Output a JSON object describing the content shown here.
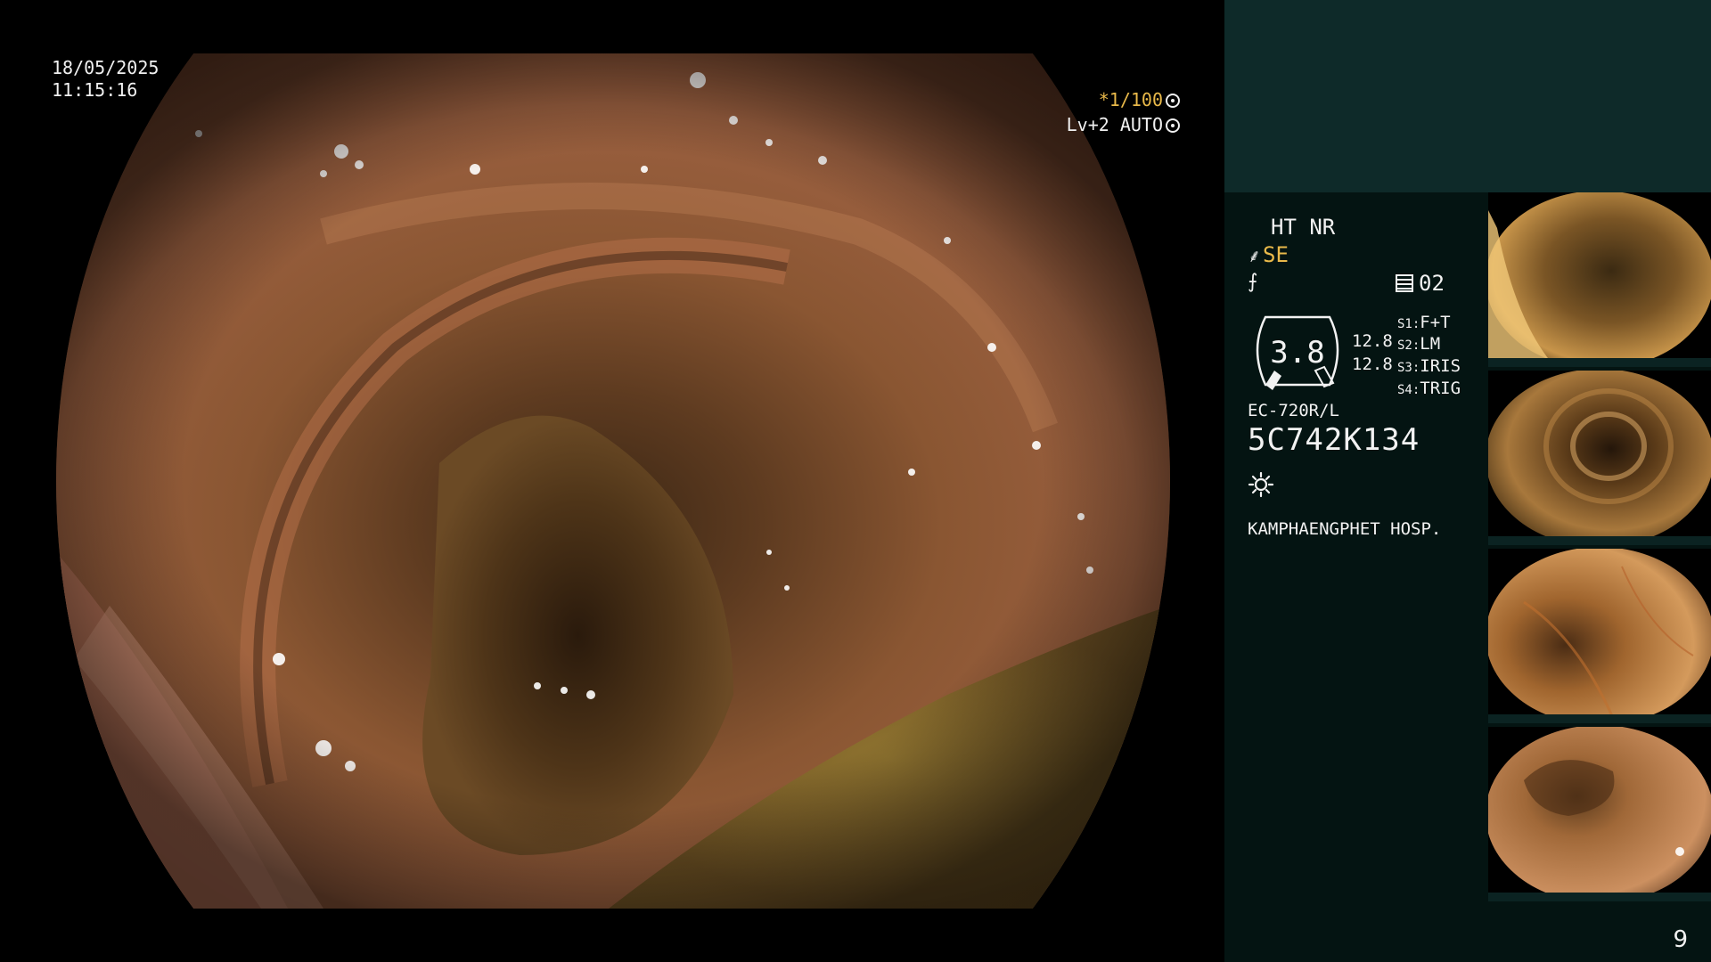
{
  "main_view": {
    "date": "18/05/2025",
    "time": "11:15:16",
    "shutter": "*1/100",
    "level": "Lv+2 AUTO"
  },
  "info_panel": {
    "ht_nr": "HT NR",
    "se_label": "SE",
    "memory_count": "02",
    "scale_value": "3.8",
    "gauge_top": "12.8",
    "gauge_bottom": "12.8",
    "settings": [
      {
        "key": "S1:",
        "value": "F+T"
      },
      {
        "key": "S2:",
        "value": "LM"
      },
      {
        "key": "S3:",
        "value": "IRIS"
      },
      {
        "key": "S4:",
        "value": "TRIG"
      }
    ],
    "scope_model": "EC-720R/L",
    "scope_serial": "5C742K134",
    "hospital": "KAMPHAENGPHET HOSP."
  },
  "thumbnails": {
    "count": 4
  },
  "page_number": "9",
  "colors": {
    "accent_amber": "#e9b94a",
    "panel_header": "#0e2a29",
    "panel_body": "#041412",
    "mucosa": "#9a5a35"
  },
  "icons": {
    "shutter": "aperture-icon",
    "level": "iris-icon",
    "se": "enhancement-icon",
    "memory": "memo-icon",
    "light": "light-icon"
  }
}
